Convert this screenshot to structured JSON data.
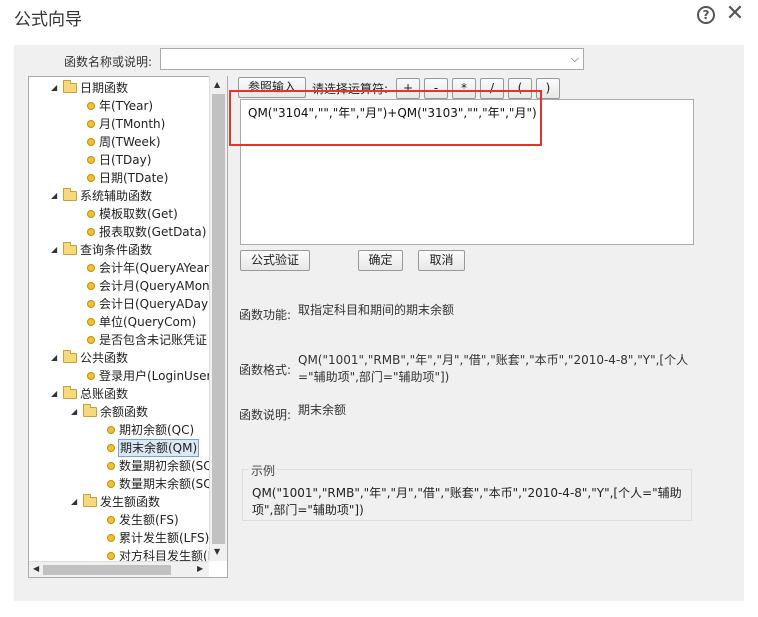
{
  "window": {
    "title": "公式向导",
    "help_glyph": "?",
    "close_glyph": "✕"
  },
  "search": {
    "label": "函数名称或说明:",
    "value": ""
  },
  "tree": {
    "groups": [
      {
        "label": "日期函数",
        "items": [
          "年(TYear)",
          "月(TMonth)",
          "周(TWeek)",
          "日(TDay)",
          "日期(TDate)"
        ]
      },
      {
        "label": "系统辅助函数",
        "items": [
          "模板取数(Get)",
          "报表取数(GetData)"
        ]
      },
      {
        "label": "查询条件函数",
        "items": [
          "会计年(QueryAYear)",
          "会计月(QueryAMonth)",
          "会计日(QueryADay)",
          "单位(QueryCom)",
          "是否包含未记账凭证"
        ]
      },
      {
        "label": "公共函数",
        "items": [
          "登录用户(LoginUser)"
        ]
      },
      {
        "label": "总账函数",
        "subgroups": [
          {
            "label": "余额函数",
            "items": [
              "期初余额(QC)",
              "期末余额(QM)",
              "数量期初余额(SQC)",
              "数量期末余额(SQM)"
            ]
          },
          {
            "label": "发生额函数",
            "items": [
              "发生额(FS)",
              "累计发生额(LFS)",
              "对方科目发生额(DFS)"
            ]
          }
        ]
      }
    ],
    "selected": "期末余额(QM)"
  },
  "toolbar": {
    "ref_input": "参照输入",
    "op_label": "请选择运算符:",
    "ops": [
      "+",
      "-",
      "*",
      "/",
      "(",
      ")"
    ]
  },
  "formula": {
    "text": "QM(\"3104\",\"\",\"年\",\"月\")+QM(\"3103\",\"\",\"年\",\"月\")"
  },
  "actions": {
    "verify": "公式验证",
    "ok": "确定",
    "cancel": "取消"
  },
  "info": {
    "function_label": "函数功能:",
    "function_value": "取指定科目和期间的期末余额",
    "format_label": "函数格式:",
    "format_value": "QM(\"1001\",\"RMB\",\"年\",\"月\",\"借\",\"账套\",\"本币\",\"2010-4-8\",\"Y\",[个人=\"辅助项\",部门=\"辅助项\"])",
    "desc_label": "函数说明:",
    "desc_value": "期末余额"
  },
  "example": {
    "title": "示例",
    "text": "QM(\"1001\",\"RMB\",\"年\",\"月\",\"借\",\"账套\",\"本币\",\"2010-4-8\",\"Y\",[个人=\"辅助项\",部门=\"辅助项\"])"
  },
  "colors": {
    "highlight_border": "#e8332d",
    "panel_bg": "#f0f0f0",
    "selected_bg": "#dbe8f6"
  }
}
